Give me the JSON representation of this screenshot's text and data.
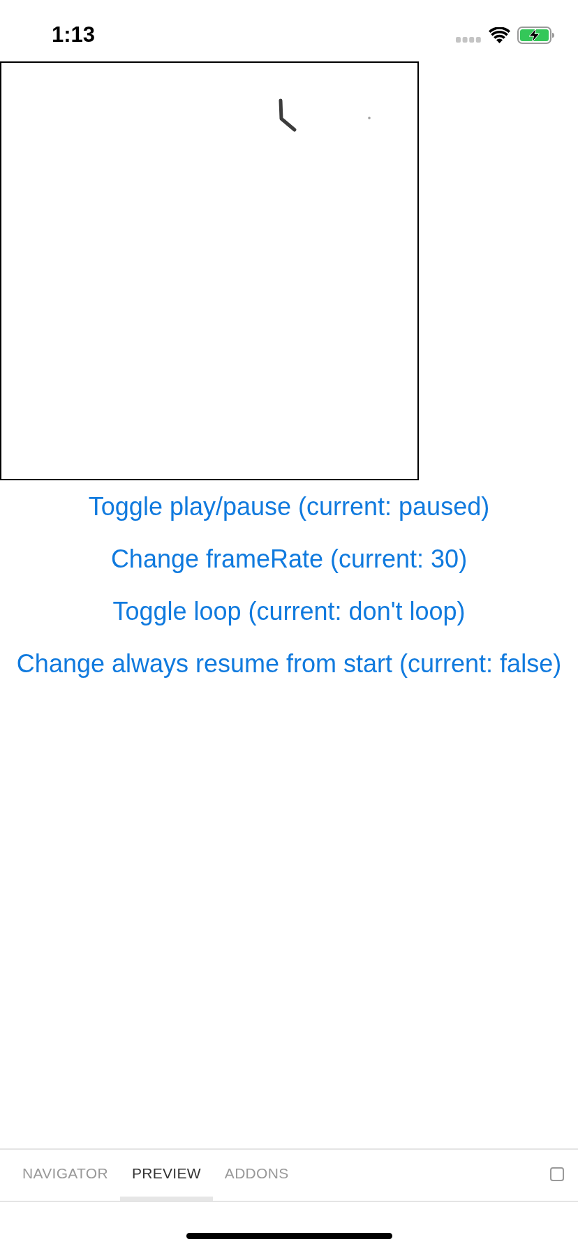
{
  "status_bar": {
    "time": "1:13"
  },
  "buttons": [
    "Toggle play/pause (current: paused)",
    "Change frameRate (current: 30)",
    "Toggle loop (current: don't loop)",
    "Change always resume from start (current: false)"
  ],
  "tabs": [
    {
      "label": "NAVIGATOR",
      "selected": false
    },
    {
      "label": "PREVIEW",
      "selected": true
    },
    {
      "label": "ADDONS",
      "selected": false
    }
  ]
}
